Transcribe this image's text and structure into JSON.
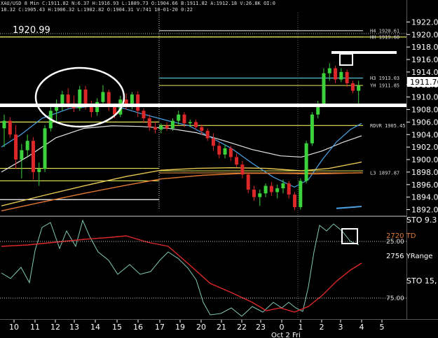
{
  "header": {
    "info1": "XAU/USD 8 Min C:1911.82 N:6.37 H:1916.93 L:1889.73 O:1904.66 B:1911.82 A:1912.18 V:26.8K OI:0",
    "info2": "18.32 C:1905.43 H:1906.32 L:1902.82 O:1904.31 V:741 10-01-20 0:22",
    "cursor_value": "1920.99"
  },
  "price_panel": {
    "last_price": "1911.76",
    "levels": [
      {
        "label": "H4 1920.61",
        "value": 1920.61,
        "color": "#d8d8d8"
      },
      {
        "label": "HH 1919.60",
        "value": 1919.6,
        "color": "#e6e65a"
      },
      {
        "label": "H3 1913.03",
        "value": 1913.03,
        "color": "#5ad0e6"
      },
      {
        "label": "YH 1911.85",
        "value": 1911.85,
        "color": "#e6e65a"
      },
      {
        "label": "RDVR 1905.45",
        "value": 1905.45,
        "color": "#e6e65a"
      },
      {
        "label": "L3 1897.87",
        "value": 1897.87,
        "color": "#e09040"
      }
    ]
  },
  "indicator_panel": {
    "label_td": "2720 TD",
    "label_yrange": "2756 YRange",
    "label_sto_top": "STO 9.3",
    "label_sto": "STO 15,",
    "level_25": "25.00",
    "level_75": "75.00"
  },
  "x_axis": {
    "date_label": "Oct 2 Fri"
  },
  "colors": {
    "candle_up": "#3cd23c",
    "candle_down": "#dc2828",
    "ema_fast": "#4aa3e6",
    "ema_mid": "#e6e6e6",
    "ema_slow": "#e6c850",
    "ema_orange": "#e07830",
    "sto_line": "#7ec8b8",
    "signal_line": "#dc2828",
    "annotation": "#ffffff"
  },
  "chart_data": {
    "type": "candlestick",
    "ylim": [
      1891.5,
      1923.5
    ],
    "ytick_labels": [
      "1922.00",
      "1920.00",
      "1918.00",
      "1916.00",
      "1914.00",
      "1912.00",
      "1910.00",
      "1908.00",
      "1906.00",
      "1904.00",
      "1902.00",
      "1900.00",
      "1898.00",
      "1896.00",
      "1894.00",
      "1892.00"
    ],
    "ytick_values": [
      1922,
      1920,
      1918,
      1916,
      1914,
      1912,
      1910,
      1908,
      1906,
      1904,
      1902,
      1900,
      1898,
      1896,
      1894,
      1892
    ],
    "xtick_labels": [
      "10",
      "11",
      "12",
      "13",
      "14",
      "15",
      "16",
      "17",
      "19",
      "20",
      "21",
      "22",
      "23",
      "0",
      "1",
      "2",
      "3",
      "4",
      "5"
    ],
    "ohlc": [
      [
        1905.0,
        1907.2,
        1902.0,
        1906.2
      ],
      [
        1906.2,
        1906.8,
        1903.5,
        1904.0
      ],
      [
        1904.0,
        1905.5,
        1898.5,
        1900.0
      ],
      [
        1900.0,
        1902.5,
        1897.0,
        1901.5
      ],
      [
        1901.5,
        1904.0,
        1900.5,
        1903.0
      ],
      [
        1903.0,
        1903.6,
        1896.8,
        1898.0
      ],
      [
        1898.0,
        1899.5,
        1895.8,
        1898.5
      ],
      [
        1898.5,
        1905.5,
        1898.0,
        1905.0
      ],
      [
        1905.0,
        1908.5,
        1904.5,
        1907.8
      ],
      [
        1907.8,
        1909.6,
        1906.0,
        1908.6
      ],
      [
        1908.6,
        1911.0,
        1907.8,
        1910.4
      ],
      [
        1910.4,
        1911.4,
        1908.2,
        1909.0
      ],
      [
        1909.0,
        1910.2,
        1907.6,
        1908.2
      ],
      [
        1908.2,
        1911.8,
        1907.8,
        1911.2
      ],
      [
        1911.2,
        1911.8,
        1908.0,
        1908.6
      ],
      [
        1908.6,
        1909.4,
        1906.8,
        1907.6
      ],
      [
        1907.6,
        1909.8,
        1907.0,
        1909.2
      ],
      [
        1909.2,
        1911.9,
        1908.6,
        1910.8
      ],
      [
        1910.8,
        1911.2,
        1907.8,
        1908.4
      ],
      [
        1908.4,
        1909.0,
        1906.6,
        1907.2
      ],
      [
        1907.2,
        1910.2,
        1906.8,
        1909.6
      ],
      [
        1909.6,
        1910.6,
        1908.0,
        1908.8
      ],
      [
        1908.8,
        1910.8,
        1908.0,
        1910.4
      ],
      [
        1910.4,
        1910.9,
        1906.8,
        1907.8
      ],
      [
        1907.8,
        1908.2,
        1905.8,
        1906.6
      ],
      [
        1906.6,
        1907.2,
        1904.6,
        1905.2
      ],
      [
        1905.2,
        1906.0,
        1904.2,
        1904.8
      ],
      [
        1904.8,
        1905.8,
        1904.2,
        1905.4
      ],
      [
        1905.4,
        1906.0,
        1904.6,
        1905.0
      ],
      [
        1905.0,
        1906.6,
        1904.6,
        1906.2
      ],
      [
        1906.2,
        1907.8,
        1905.6,
        1907.2
      ],
      [
        1907.2,
        1907.6,
        1905.2,
        1905.8
      ],
      [
        1905.8,
        1906.4,
        1905.2,
        1906.0
      ],
      [
        1906.0,
        1906.4,
        1904.8,
        1905.2
      ],
      [
        1905.2,
        1905.6,
        1904.0,
        1904.6
      ],
      [
        1904.6,
        1905.0,
        1903.0,
        1903.4
      ],
      [
        1903.4,
        1904.2,
        1901.4,
        1902.2
      ],
      [
        1902.2,
        1902.8,
        1900.2,
        1900.8
      ],
      [
        1900.8,
        1902.4,
        1900.2,
        1901.8
      ],
      [
        1901.8,
        1902.2,
        1899.8,
        1900.4
      ],
      [
        1900.4,
        1901.0,
        1898.8,
        1899.2
      ],
      [
        1899.2,
        1899.8,
        1897.0,
        1897.6
      ],
      [
        1897.6,
        1898.0,
        1894.6,
        1895.2
      ],
      [
        1895.2,
        1895.8,
        1893.4,
        1894.0
      ],
      [
        1894.0,
        1895.2,
        1892.6,
        1894.6
      ],
      [
        1894.6,
        1896.2,
        1894.0,
        1895.8
      ],
      [
        1895.8,
        1896.4,
        1894.2,
        1894.8
      ],
      [
        1894.8,
        1896.0,
        1893.8,
        1895.4
      ],
      [
        1895.4,
        1896.8,
        1894.6,
        1896.2
      ],
      [
        1896.2,
        1896.6,
        1893.8,
        1894.4
      ],
      [
        1894.4,
        1894.8,
        1891.9,
        1892.4
      ],
      [
        1892.4,
        1897.0,
        1892.0,
        1896.6
      ],
      [
        1896.6,
        1903.0,
        1896.2,
        1902.6
      ],
      [
        1902.6,
        1907.6,
        1902.2,
        1907.2
      ],
      [
        1907.2,
        1909.4,
        1906.6,
        1908.8
      ],
      [
        1908.8,
        1914.6,
        1908.4,
        1913.8
      ],
      [
        1913.8,
        1915.4,
        1912.6,
        1914.6
      ],
      [
        1914.6,
        1915.0,
        1912.2,
        1912.8
      ],
      [
        1912.8,
        1914.6,
        1912.4,
        1914.0
      ],
      [
        1914.0,
        1914.4,
        1911.6,
        1912.2
      ],
      [
        1912.2,
        1912.6,
        1910.6,
        1911.0
      ],
      [
        1911.0,
        1912.6,
        1908.6,
        1911.8
      ]
    ]
  }
}
